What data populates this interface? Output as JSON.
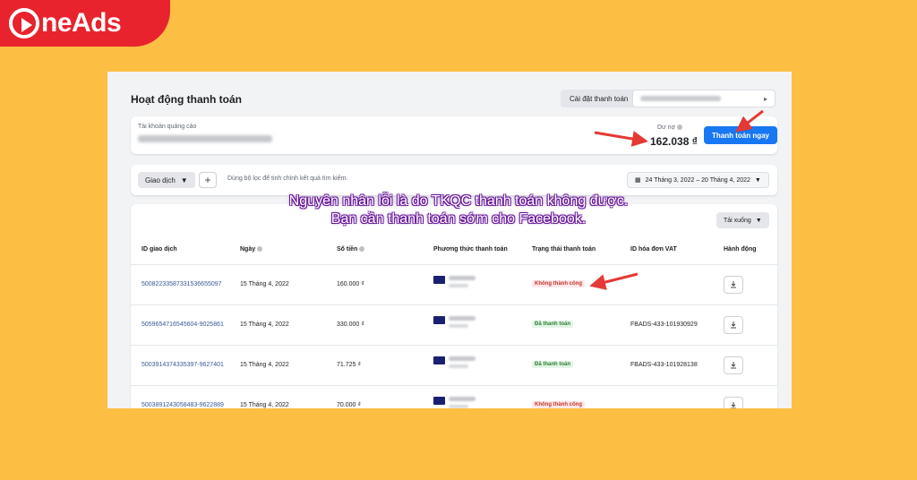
{
  "brand": {
    "name": "OneAds",
    "logo_text": "neAds",
    "color": "#e8232d"
  },
  "page": {
    "title": "Hoạt động thanh toán",
    "settings_button": "Cài đặt thanh toán",
    "account_label": "Tài khoản quảng cáo",
    "debt_label": "Dư nợ",
    "debt_value": "162.038 ₫",
    "pay_button": "Thanh toán ngay"
  },
  "filter": {
    "type_button": "Giao dịch",
    "add_label": "+",
    "hint": "Dùng bộ lọc để tinh chỉnh kết quả tìm kiếm.",
    "date_range": "24 Tháng 3, 2022 – 20 Tháng 4, 2022"
  },
  "table": {
    "download_button": "Tải xuống",
    "columns": [
      "ID giao dịch",
      "Ngày",
      "Số tiền",
      "Phương thức thanh toán",
      "Trạng thái thanh toán",
      "ID hóa đơn VAT",
      "Hành động"
    ],
    "rows": [
      {
        "id": "50082233587331536655097",
        "date": "15 Tháng 4, 2022",
        "amount": "160.000 ₫",
        "status": "Không thành công",
        "status_type": "fail",
        "vat": ""
      },
      {
        "id": "5059654716545604-9025861",
        "date": "15 Tháng 4, 2022",
        "amount": "330.000 ₫",
        "status": "Đã thanh toán",
        "status_type": "ok",
        "vat": "FBADS-433-101930929"
      },
      {
        "id": "5003914374335397-9627401",
        "date": "15 Tháng 4, 2022",
        "amount": "71.725 ₫",
        "status": "Đã thanh toán",
        "status_type": "ok",
        "vat": "FBADS-433-101928138"
      },
      {
        "id": "5003891243058483-9622889",
        "date": "15 Tháng 4, 2022",
        "amount": "70.000 ₫",
        "status": "Không thành công",
        "status_type": "fail",
        "vat": ""
      }
    ]
  },
  "annotation": {
    "line1": "Nguyên nhân lỗi là do TKQC thanh toán không được.",
    "line2": "Bạn cần thanh toán sớm cho Facebook."
  },
  "colors": {
    "background": "#fdbe44",
    "primary_button": "#1877f2",
    "arrow": "#e53935",
    "annotation_outline": "#6a1b9a"
  }
}
